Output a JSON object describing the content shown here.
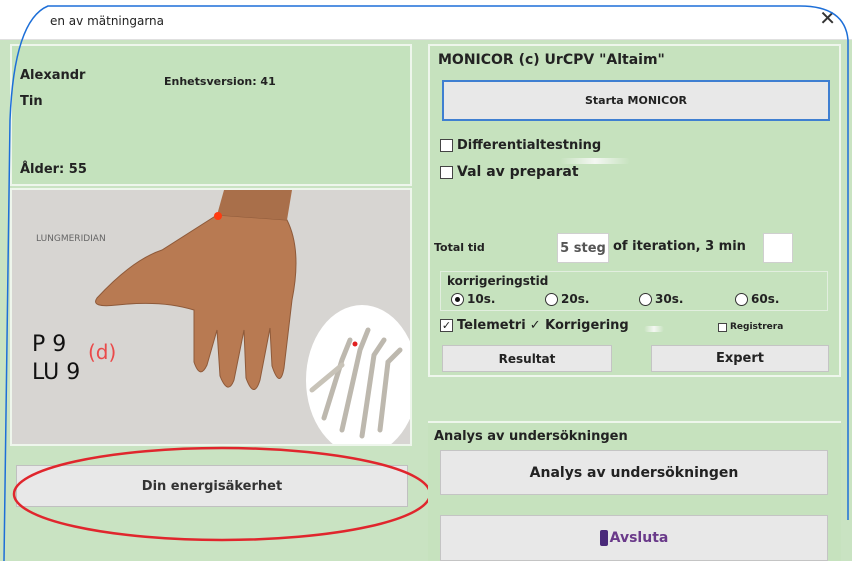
{
  "window": {
    "title": "en av mätningarna",
    "close_glyph": "✕"
  },
  "patient": {
    "first_name": "Alexandr",
    "last_name": "Tin",
    "device_version": "Enhetsversion: 41",
    "age": "Ålder: 55"
  },
  "image": {
    "meridian": "LUNGMERIDIAN",
    "point_line1": "P 9",
    "point_line2": "LU 9",
    "point_suffix": "(d)"
  },
  "left_buttons": {
    "energy": "Din energisäkerhet"
  },
  "main": {
    "app_title": "MONICOR (c) UrCPV \"Altaim\"",
    "start_button": "Starta MONICOR",
    "differential": {
      "label": "Differentialtestning",
      "checked": false
    },
    "preparation": {
      "label": "Val av preparat",
      "checked": false
    },
    "total_time_label": "Total tid",
    "steps_value": "5 steg",
    "iteration_label": "of iteration, 3 min",
    "iteration_value": "",
    "correction": {
      "label": "korrigeringstid",
      "options": [
        "10s.",
        "20s.",
        "30s.",
        "60s."
      ],
      "selected": "10s."
    },
    "telemetry_label": "Telemetri",
    "telemetry_checked": true,
    "correction_check": "✓ Korrigering",
    "register_label": "Registrera",
    "result_button": "Resultat",
    "expert_button": "Expert"
  },
  "analys": {
    "group_label": "Analys av undersökningen",
    "button": "Analys av undersökningen",
    "exit_button": "Avsluta"
  },
  "colors": {
    "panel": "#c6e2be",
    "accent_border": "#3f7fd1",
    "annotation": "#e0262d"
  }
}
